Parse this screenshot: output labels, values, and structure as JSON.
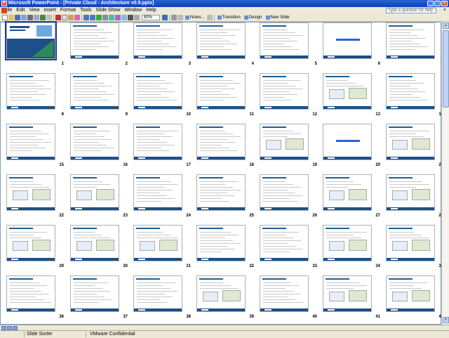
{
  "window": {
    "title": "Microsoft PowerPoint - [Private Cloud - Architecture v0.9.pptx]",
    "app_icon": "powerpoint-icon"
  },
  "menu": [
    "File",
    "Edit",
    "View",
    "Insert",
    "Format",
    "Tools",
    "Slide Show",
    "Window",
    "Help"
  ],
  "help_placeholder": "Type a question for help",
  "toolbar": {
    "zoom": "80%",
    "notes": "Notes...",
    "transition": "Transition",
    "design": "Design",
    "new_slide": "New Slide"
  },
  "status": {
    "view": "Slide Sorter",
    "template": "VMware Confidential"
  },
  "slides": {
    "count": 42,
    "columns": 7,
    "selected": 1
  },
  "colors": {
    "accent": "#1d4f8a",
    "title_blue": "#2b62d8",
    "selection": "#1f3fa8"
  }
}
